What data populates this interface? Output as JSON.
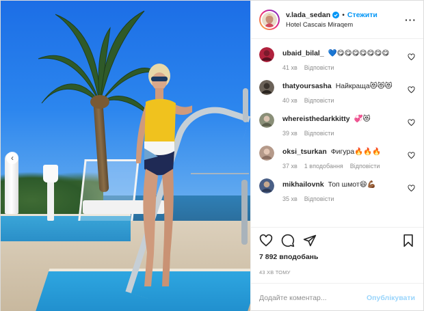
{
  "post": {
    "username": "v.lada_sedan",
    "follow_label": "Стежити",
    "location": "Hotel Cascais Miraqem",
    "more_icon": "more-horizontal-icon",
    "verified_color": "#0095f6"
  },
  "comments": [
    {
      "user": "ubaid_bilal_",
      "text": "💙😋😋😋😋😋😋😋",
      "time": "41 хв",
      "reply": "Відповісти",
      "replies": "",
      "avatar_color": "#b0223d"
    },
    {
      "user": "thatyoursasha",
      "text": "Найкраща😻😻😻",
      "time": "40 хв",
      "reply": "Відповісти",
      "replies": "",
      "avatar_color": "#6b6258"
    },
    {
      "user": "whereisthedarkkitty",
      "text": "💞😻",
      "time": "39 хв",
      "reply": "Відповісти",
      "replies": "",
      "avatar_color": "#8a8f78"
    },
    {
      "user": "oksi_tsurkan",
      "text": "Фигура🔥🔥🔥",
      "time": "37 хв",
      "reply": "Відповісти",
      "replies": "1 вподобання",
      "avatar_color": "#b59a8a"
    },
    {
      "user": "mikhailovnk",
      "text": "Топ шмот😄💪🏾",
      "time": "35 хв",
      "reply": "Відповісти",
      "replies": "",
      "avatar_color": "#4a5f86"
    }
  ],
  "stats": {
    "likes": "7 892 вподобань",
    "time_ago": "43 ХВ ТОМУ"
  },
  "composer": {
    "placeholder": "Додайте коментар...",
    "publish_label": "Опублікувати"
  },
  "colors": {
    "accent": "#0095f6",
    "muted": "#8e8e8e",
    "text": "#262626"
  }
}
